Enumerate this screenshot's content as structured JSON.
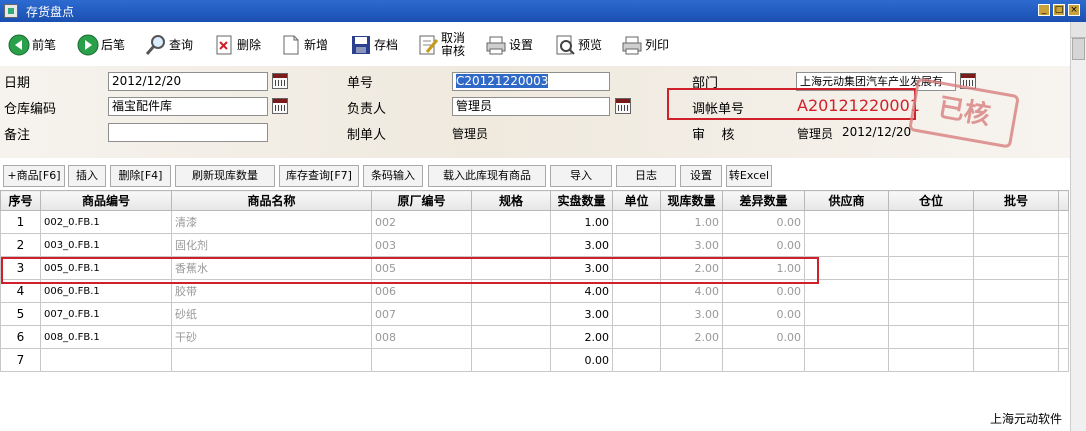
{
  "window": {
    "title": "存货盘点",
    "app_icon": "app-icon"
  },
  "toolbar": {
    "items": [
      {
        "label": "前笔",
        "icon": "arrow-left-icon"
      },
      {
        "label": "后笔",
        "icon": "arrow-right-icon"
      },
      {
        "label": "查询",
        "icon": "magnifier-icon"
      },
      {
        "label": "删除",
        "icon": "delete-doc-icon"
      },
      {
        "label": "新增",
        "icon": "new-doc-icon"
      },
      {
        "label": "存档",
        "icon": "save-icon"
      },
      {
        "label": "取消审核",
        "icon": "unapprove-icon"
      },
      {
        "label": "设置",
        "icon": "printer-settings-icon"
      },
      {
        "label": "预览",
        "icon": "preview-icon"
      },
      {
        "label": "列印",
        "icon": "printer-icon"
      }
    ]
  },
  "form": {
    "date_label": "日期",
    "date_value": "2012/12/20",
    "warehouse_label": "仓库编码",
    "warehouse_value": "福宝配件库",
    "note_label": "备注",
    "note_value": "",
    "docno_label": "单号",
    "docno_value": "C20121220003",
    "owner_label": "负责人",
    "owner_value": "管理员",
    "maker_label": "制单人",
    "maker_value": "管理员",
    "dept_label": "部门",
    "dept_value": "上海元动集团汽车产业发展有",
    "adjust_label": "调帐单号",
    "adjust_value": "A20121220001",
    "review_label": "审    核",
    "review_user": "管理员",
    "review_date": "2012/12/20",
    "stamp_text": "已核"
  },
  "buttons": [
    "+商品[F6]",
    "插入",
    "删除[F4]",
    "刷新现库数量",
    "库存查询[F7]",
    "条码输入",
    "载入此库现有商品",
    "导入",
    "日志",
    "设置",
    "转Excel"
  ],
  "table": {
    "headers": [
      "序号",
      "商品编号",
      "商品名称",
      "原厂编号",
      "规格",
      "实盘数量",
      "单位",
      "现库数量",
      "差异数量",
      "供应商",
      "仓位",
      "批号"
    ],
    "rows": [
      [
        "1",
        "002_0.FB.1",
        "清漆",
        "002",
        "",
        "1.00",
        "",
        "1.00",
        "0.00",
        "",
        "",
        ""
      ],
      [
        "2",
        "003_0.FB.1",
        "固化剂",
        "003",
        "",
        "3.00",
        "",
        "3.00",
        "0.00",
        "",
        "",
        ""
      ],
      [
        "3",
        "005_0.FB.1",
        "香蕉水",
        "005",
        "",
        "3.00",
        "",
        "2.00",
        "1.00",
        "",
        "",
        ""
      ],
      [
        "4",
        "006_0.FB.1",
        "胶带",
        "006",
        "",
        "4.00",
        "",
        "4.00",
        "0.00",
        "",
        "",
        ""
      ],
      [
        "5",
        "007_0.FB.1",
        "砂纸",
        "007",
        "",
        "3.00",
        "",
        "3.00",
        "0.00",
        "",
        "",
        ""
      ],
      [
        "6",
        "008_0.FB.1",
        "干砂",
        "008",
        "",
        "2.00",
        "",
        "2.00",
        "0.00",
        "",
        "",
        ""
      ],
      [
        "7",
        "",
        "",
        "",
        "",
        "0.00",
        "",
        "",
        "",
        "",
        "",
        ""
      ]
    ]
  },
  "footer": {
    "text": "上海元动软件"
  },
  "colors": {
    "titlebar": "#1a4fb0",
    "highlight": "#d0202a",
    "stamp": "#d98080"
  }
}
